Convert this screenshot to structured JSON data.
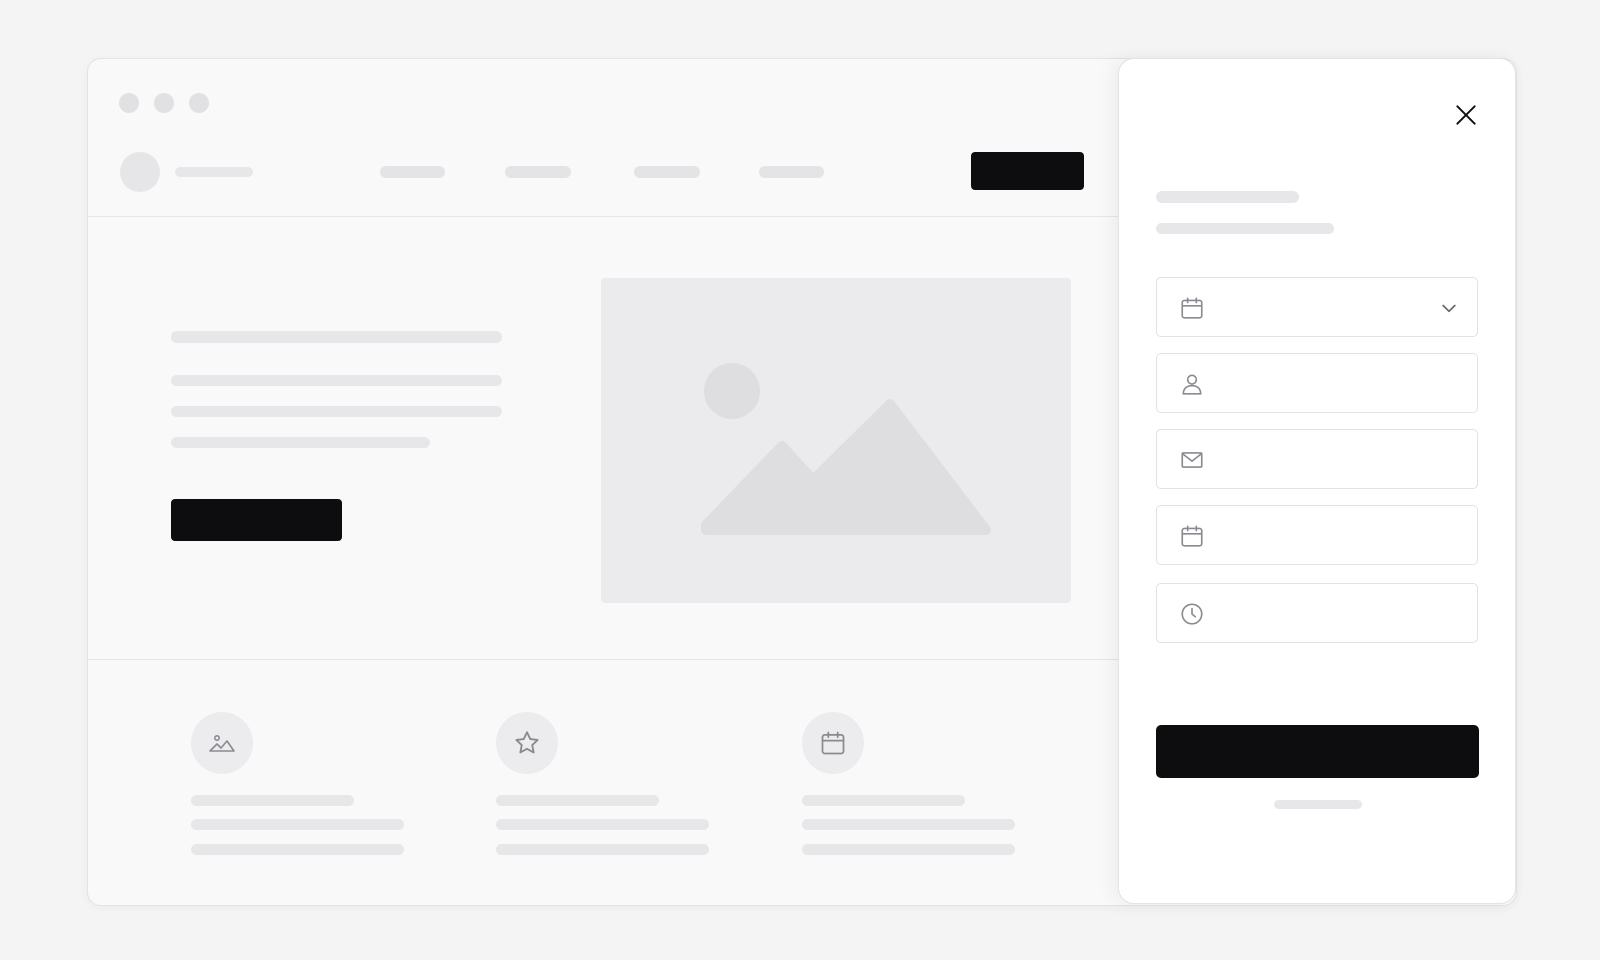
{
  "window": {
    "controls": [
      "close",
      "minimize",
      "maximize"
    ],
    "nav": {
      "logo": "placeholder-logo",
      "items": [
        "",
        "",
        "",
        ""
      ],
      "cta_label": ""
    },
    "hero": {
      "cta_label": "",
      "image_icon": "image-placeholder-icon"
    },
    "features": [
      {
        "icon": "image-icon"
      },
      {
        "icon": "star-icon"
      },
      {
        "icon": "calendar-icon"
      }
    ]
  },
  "panel": {
    "close_icon": "close-icon",
    "fields": [
      {
        "icon": "calendar-icon",
        "type": "select",
        "value": "",
        "placeholder": "",
        "chevron": "chevron-down-icon"
      },
      {
        "icon": "user-icon",
        "type": "text",
        "value": "",
        "placeholder": ""
      },
      {
        "icon": "mail-icon",
        "type": "email",
        "value": "",
        "placeholder": ""
      },
      {
        "icon": "calendar-icon",
        "type": "date",
        "value": "",
        "placeholder": ""
      },
      {
        "icon": "clock-icon",
        "type": "time",
        "value": "",
        "placeholder": ""
      }
    ],
    "submit_label": ""
  },
  "colors": {
    "background": "#f4f4f5",
    "placeholder_bar": "#e7e7ea",
    "primary_button": "#0d0d0f",
    "panel": "#ffffff",
    "icon_stroke": "#8a8a90"
  }
}
